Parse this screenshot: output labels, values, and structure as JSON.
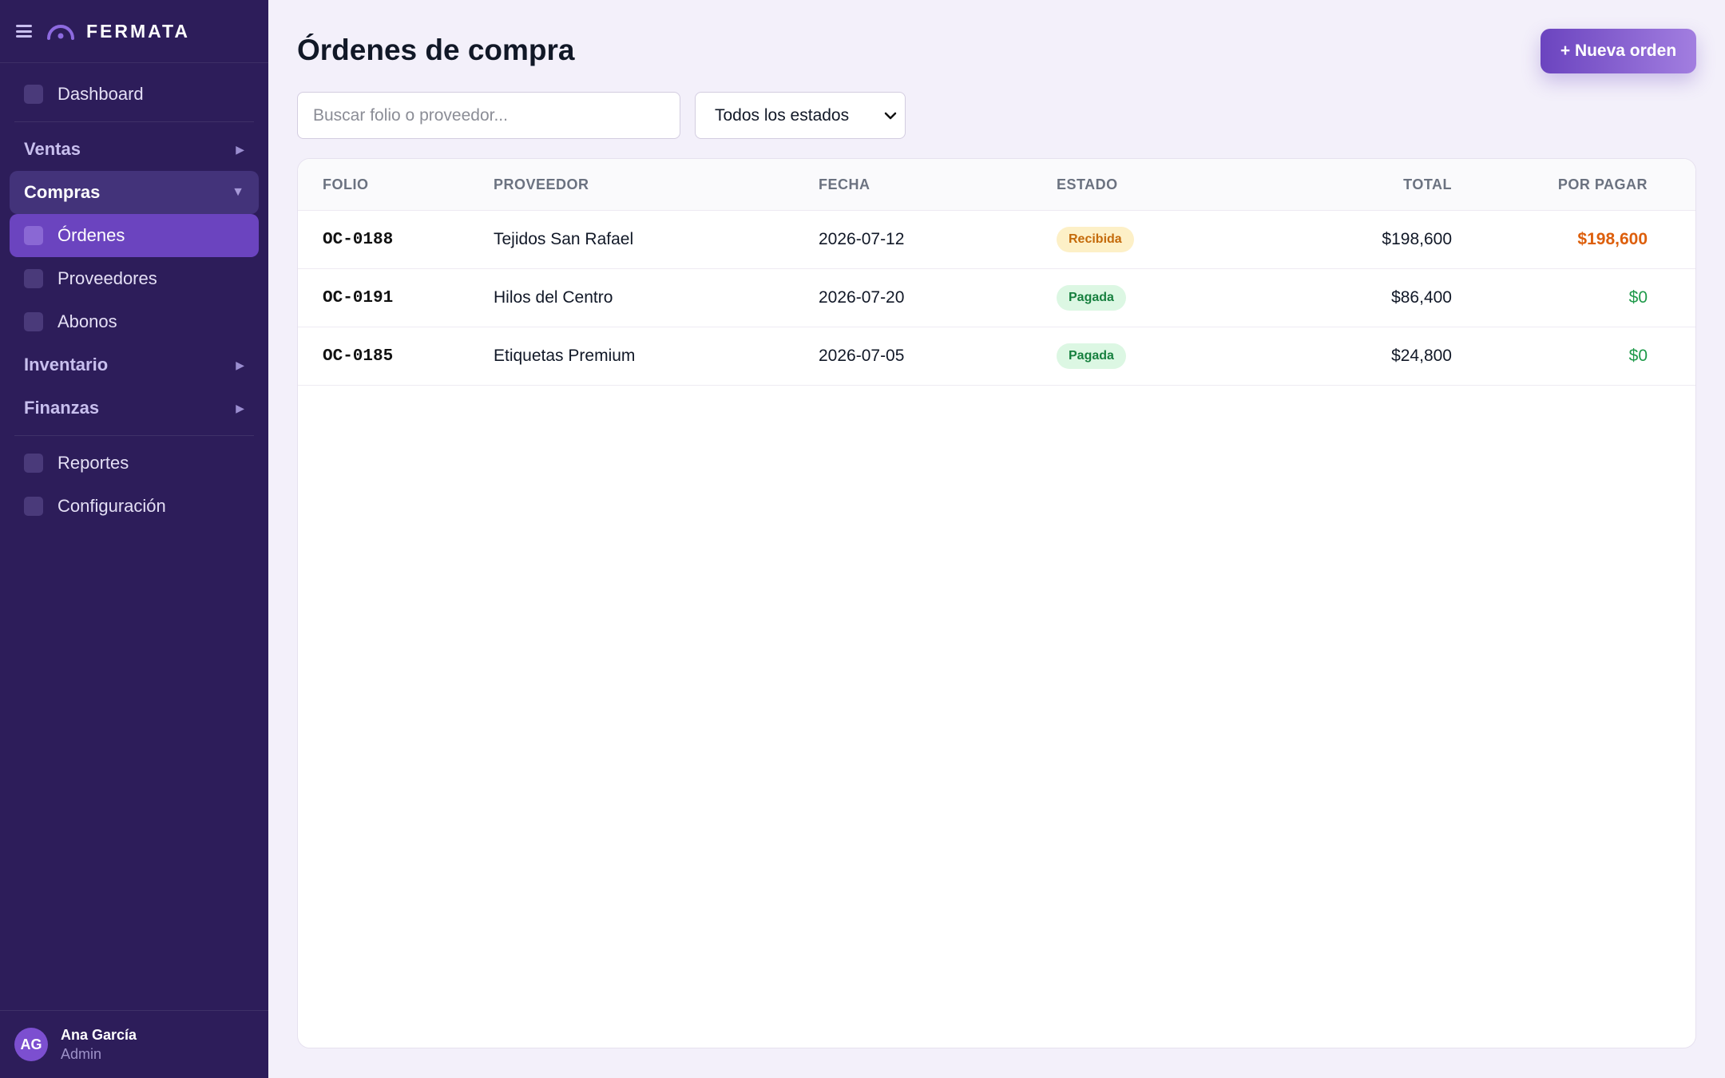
{
  "brand": {
    "name": "FERMATA"
  },
  "sidebar": {
    "dashboard": "Dashboard",
    "groups": {
      "ventas": "Ventas",
      "compras": "Compras",
      "inventario": "Inventario",
      "finanzas": "Finanzas"
    },
    "compras_items": [
      "Órdenes",
      "Proveedores",
      "Abonos"
    ],
    "active_item": "Órdenes",
    "reportes": "Reportes",
    "configuracion": "Configuración",
    "arrow_collapsed": "▶",
    "arrow_expanded": "▼"
  },
  "user": {
    "initials": "AG",
    "name": "Ana García",
    "role": "Admin"
  },
  "page": {
    "title": "Órdenes de compra",
    "new_button": "+ Nueva orden",
    "search_placeholder": "Buscar folio o proveedor...",
    "status_filter": "Todos los estados"
  },
  "table": {
    "headers": [
      "FOLIO",
      "PROVEEDOR",
      "FECHA",
      "ESTADO",
      "TOTAL",
      "POR PAGAR"
    ],
    "rows": [
      {
        "folio": "OC-0188",
        "proveedor": "Tejidos San Rafael",
        "fecha": "2026-07-12",
        "estado": "Recibida",
        "total": "$198,600",
        "por_pagar": "$198,600"
      },
      {
        "folio": "OC-0191",
        "proveedor": "Hilos del Centro",
        "fecha": "2026-07-20",
        "estado": "Pagada",
        "total": "$86,400",
        "por_pagar": "$0"
      },
      {
        "folio": "OC-0185",
        "proveedor": "Etiquetas Premium",
        "fecha": "2026-07-05",
        "estado": "Pagada",
        "total": "$24,800",
        "por_pagar": "$0"
      }
    ]
  },
  "colors": {
    "sidebar_bg": "#2d1d5a",
    "accent": "#6b44bf",
    "pending": "#dd5f0c",
    "paid": "#1f9a4a"
  }
}
